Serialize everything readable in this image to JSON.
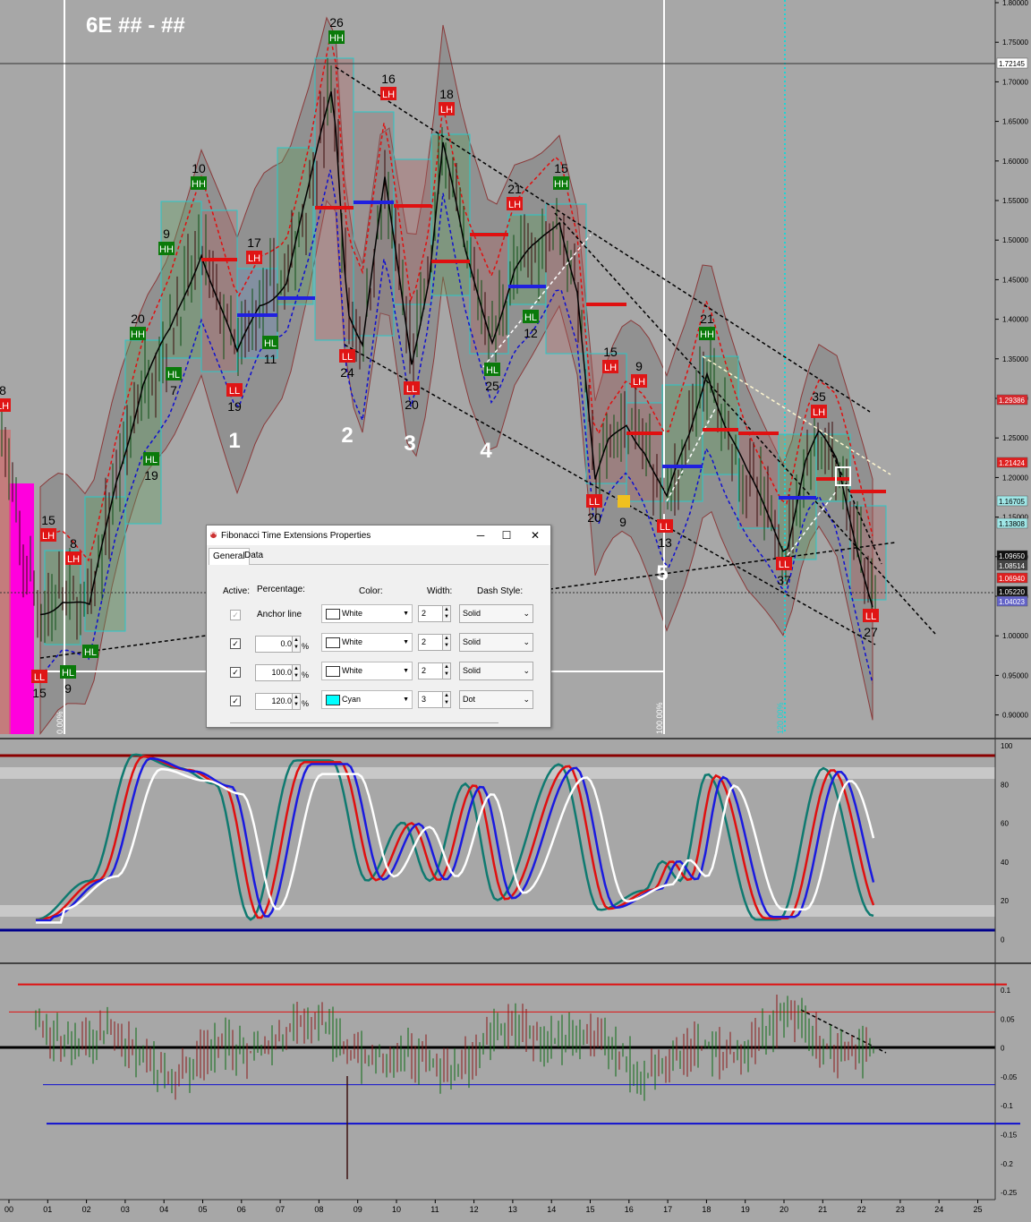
{
  "chart": {
    "title": "6E  ## - ##",
    "price_axis": [
      "1.80000",
      "1.75000",
      "1.70000",
      "1.65000",
      "1.60000",
      "1.55000",
      "1.50000",
      "1.45000",
      "1.40000",
      "1.35000",
      "1.30000",
      "1.25000",
      "1.20000",
      "1.15000",
      "1.10000",
      "1.05000",
      "1.00000",
      "0.95000",
      "0.90000"
    ],
    "price_markers": [
      {
        "label": "1.72145",
        "bg": "#ffffff",
        "fg": "#000000"
      },
      {
        "label": "1.29386",
        "bg": "#d8282d",
        "fg": "#ffffff"
      },
      {
        "label": "1.21424",
        "bg": "#e02020",
        "fg": "#ffffff"
      },
      {
        "label": "1.16705",
        "bg": "#9fe6e6",
        "fg": "#000000"
      },
      {
        "label": "1.13808",
        "bg": "#9fe6e6",
        "fg": "#000000"
      },
      {
        "label": "1.09650",
        "bg": "#111111",
        "fg": "#ffffff"
      },
      {
        "label": "1.08514",
        "bg": "#444444",
        "fg": "#ffffff"
      },
      {
        "label": "1.06940",
        "bg": "#e02020",
        "fg": "#ffffff"
      },
      {
        "label": "1.05220",
        "bg": "#111111",
        "fg": "#ffffff"
      },
      {
        "label": "1.04023",
        "bg": "#6464c8",
        "fg": "#ffffff"
      }
    ],
    "wave_numbers": [
      "1",
      "2",
      "3",
      "4",
      "5"
    ],
    "swing_labels": [
      {
        "tag": "LH",
        "num": "8",
        "type": "LH"
      },
      {
        "tag": "LH",
        "num": "15",
        "type": "LH"
      },
      {
        "tag": "LH",
        "num": "8",
        "type": "LH"
      },
      {
        "tag": "LL",
        "num": "15",
        "type": "LL"
      },
      {
        "tag": "HL",
        "num": "9",
        "type": "HL"
      },
      {
        "tag": "HL",
        "num": "",
        "type": "HL"
      },
      {
        "tag": "HH",
        "num": "9",
        "type": "HH"
      },
      {
        "tag": "HH",
        "num": "20",
        "type": "HH"
      },
      {
        "tag": "HL",
        "num": "7",
        "type": "HL"
      },
      {
        "tag": "HL",
        "num": "19",
        "type": "HL"
      },
      {
        "tag": "HH",
        "num": "10",
        "type": "HH"
      },
      {
        "tag": "LL",
        "num": "19",
        "type": "LL"
      },
      {
        "tag": "LH",
        "num": "17",
        "type": "LH"
      },
      {
        "tag": "HL",
        "num": "11",
        "type": "HL"
      },
      {
        "tag": "HH",
        "num": "26",
        "type": "HH"
      },
      {
        "tag": "LL",
        "num": "24",
        "type": "LL"
      },
      {
        "tag": "LH",
        "num": "16",
        "type": "LH"
      },
      {
        "tag": "LL",
        "num": "20",
        "type": "LL"
      },
      {
        "tag": "LH",
        "num": "18",
        "type": "LH"
      },
      {
        "tag": "HL",
        "num": "25",
        "type": "HL"
      },
      {
        "tag": "LH",
        "num": "21",
        "type": "LH"
      },
      {
        "tag": "HL",
        "num": "12",
        "type": "HL"
      },
      {
        "tag": "HH",
        "num": "15",
        "type": "HH"
      },
      {
        "tag": "LH",
        "num": "15",
        "type": "LH"
      },
      {
        "tag": "LL",
        "num": "20",
        "type": "LL"
      },
      {
        "tag": "LH",
        "num": "9",
        "type": "LH"
      },
      {
        "tag": "LL",
        "num": "13",
        "type": "LL"
      },
      {
        "tag": "HH",
        "num": "21",
        "type": "HH"
      },
      {
        "tag": "LH",
        "num": "35",
        "type": "LH"
      },
      {
        "tag": "LL",
        "num": "37",
        "type": "LL"
      },
      {
        "tag": "LL",
        "num": "27",
        "type": "LL"
      },
      {
        "tag": "LL",
        "num": "9",
        "type": "LL"
      }
    ],
    "fib_labels": [
      "0.00%",
      "100.00%",
      "120.00%"
    ],
    "osc_axis": [
      "100",
      "80",
      "60",
      "40",
      "20",
      "0"
    ],
    "hist_axis": [
      "0.1",
      "0.05",
      "0",
      "-0.05",
      "-0.1",
      "-0.15",
      "-0.2",
      "-0.25"
    ],
    "time_axis": [
      "00",
      "01",
      "02",
      "03",
      "04",
      "05",
      "06",
      "07",
      "08",
      "09",
      "10",
      "11",
      "12",
      "13",
      "14",
      "15",
      "16",
      "17",
      "18",
      "19",
      "20",
      "21",
      "22",
      "23",
      "24",
      "25"
    ],
    "colors": {
      "bg": "#a7a7a7",
      "bull": "#0e6b16",
      "bear": "#9b1717",
      "cyan": "#19d6d6",
      "magenta": "#ff00dd"
    }
  },
  "dialog": {
    "title": "Fibonacci Time Extensions Properties",
    "minimize": "─",
    "maximize": "☐",
    "close": "✕",
    "tabs": [
      "General",
      "Data"
    ],
    "headers": {
      "active": "Active:",
      "percentage": "Percentage:",
      "color": "Color:",
      "width": "Width:",
      "dash": "Dash Style:"
    },
    "rows": [
      {
        "checked": "✓",
        "anchor": "Anchor line",
        "pct": "",
        "color": "White",
        "swatch": "#ffffff",
        "width": "2",
        "dash": "Solid"
      },
      {
        "checked": "✓",
        "anchor": "",
        "pct": "0.0",
        "color": "White",
        "swatch": "#ffffff",
        "width": "2",
        "dash": "Solid"
      },
      {
        "checked": "✓",
        "anchor": "",
        "pct": "100.0",
        "color": "White",
        "swatch": "#ffffff",
        "width": "2",
        "dash": "Solid"
      },
      {
        "checked": "✓",
        "anchor": "",
        "pct": "120.0",
        "color": "Cyan",
        "swatch": "#00ffff",
        "width": "3",
        "dash": "Dot"
      }
    ],
    "pct_symbol": "%"
  }
}
